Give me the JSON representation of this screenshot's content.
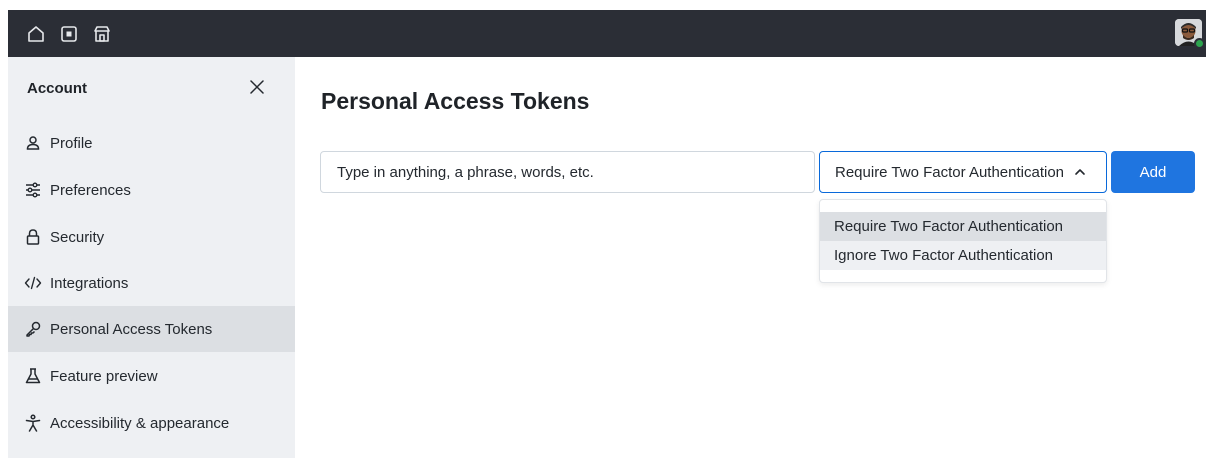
{
  "topbar": {
    "icons": [
      "home-icon",
      "inbox-icon",
      "marketplace-icon"
    ],
    "avatar": "user-avatar",
    "status_color": "#2da44e"
  },
  "sidebar": {
    "title": "Account",
    "items": [
      {
        "label": "Profile",
        "icon": "person-icon"
      },
      {
        "label": "Preferences",
        "icon": "sliders-icon"
      },
      {
        "label": "Security",
        "icon": "lock-icon"
      },
      {
        "label": "Integrations",
        "icon": "code-icon"
      },
      {
        "label": "Personal Access Tokens",
        "icon": "key-icon",
        "active": true
      },
      {
        "label": "Feature preview",
        "icon": "beaker-icon"
      },
      {
        "label": "Accessibility & appearance",
        "icon": "accessibility-icon"
      }
    ]
  },
  "main": {
    "title": "Personal Access Tokens",
    "search": {
      "placeholder": "Type in anything, a phrase, words, etc.",
      "value": ""
    },
    "select": {
      "selected": "Require Two Factor Authentication",
      "options": [
        "Require Two Factor Authentication",
        "Ignore Two Factor Authentication"
      ]
    },
    "add_label": "Add",
    "accent_color": "#1f75e0"
  }
}
